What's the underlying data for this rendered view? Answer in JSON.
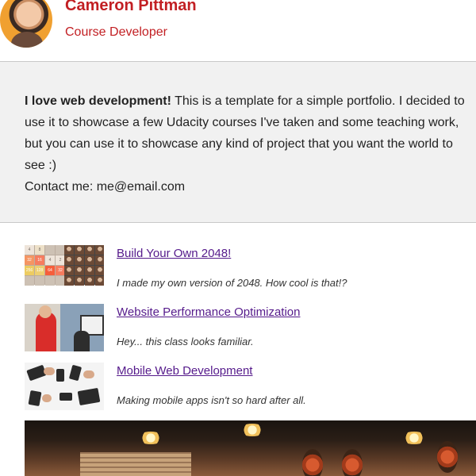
{
  "header": {
    "name": "Cameron Pittman",
    "role": "Course Developer"
  },
  "intro": {
    "lead": "I love web development!",
    "body": " This is a template for a simple portfolio. I decided to use it to showcase a few Udacity courses I've taken and some teaching work, but you can use it to showcase any kind of project that you want the world to see :)",
    "contact": "Contact me: me@email.com"
  },
  "projects": [
    {
      "title": "Build Your Own 2048!",
      "description": "I made my own version of 2048. How cool is that!?",
      "tiles": [
        "4",
        "8",
        "",
        "",
        "32",
        "16",
        "4",
        "2",
        "256",
        "128",
        "64",
        "32",
        "",
        "",
        "",
        ""
      ]
    },
    {
      "title": "Website Performance Optimization",
      "description": "Hey... this class looks familiar."
    },
    {
      "title": "Mobile Web Development",
      "description": "Making mobile apps isn't so hard after all."
    }
  ],
  "colors": {
    "accent": "#c21f23",
    "link": "#551a8b",
    "intro_bg": "#f1f1f1"
  }
}
